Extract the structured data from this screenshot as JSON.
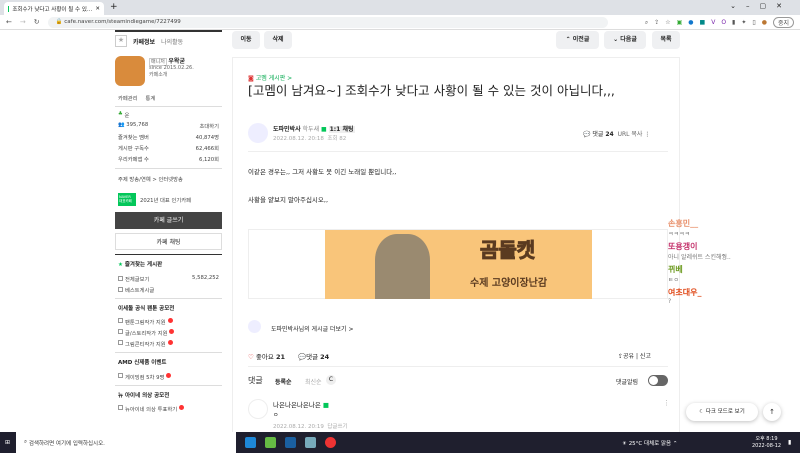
{
  "browser": {
    "tab_title": "조회수가 낮다고 사황이 될 수 있…",
    "url": "cafe.naver.com/steamindiegame/7227499",
    "profile": "중지"
  },
  "sidebar": {
    "tab_info": "카페정보",
    "tab_activity": "나의활동",
    "manager_badge": "매니저",
    "cafe_owner": "우왁굳",
    "since": "since 2015.02.26.",
    "intro": "카페소개",
    "manage": "카페관리",
    "stats": "통계",
    "level": "운",
    "members": "395,768",
    "invite": "초대하기",
    "stats_rows": [
      {
        "label": "즐겨찾는 멤버",
        "value": "40,874명"
      },
      {
        "label": "게시판 구독수",
        "value": "62,466회"
      },
      {
        "label": "우리카페앱 수",
        "value": "6,120회"
      }
    ],
    "topic": "주제 방송/연예 > 인터넷방송",
    "naver_badge": "NAVER 대표카페",
    "award": "2021년 대표 인기카페",
    "write_btn": "카페 글쓰기",
    "chat_btn": "카페 채팅",
    "fav_boards": "즐겨찾는 게시판",
    "boards": [
      {
        "label": "전체글보기",
        "count": "5,582,252"
      },
      {
        "label": "베스트게시글",
        "count": ""
      }
    ],
    "sections": [
      {
        "title": "이세돌 공식 팬툰 공모전",
        "items": [
          "팬툰그림작가 지원",
          "글/스토리작가 지원",
          "그림콘티작가 지원"
        ]
      },
      {
        "title": "AMD 신제품 이벤트",
        "items": [
          "게이밍컴 5차 9명"
        ]
      },
      {
        "title": "뉴 아이네 의상 공모전",
        "items": [
          "뉴아이네 의상 투표하기"
        ]
      }
    ]
  },
  "toolbar": {
    "move": "이동",
    "delete": "삭제",
    "prev": "이전글",
    "next": "다음글",
    "list": "목록"
  },
  "article": {
    "board": "고멤 게시판 >",
    "title": "[고멤이 남겨요~] 조회수가 낮다고 사황이 될 수 있는 것이 아닙니다,,,",
    "author": "도파민박사",
    "grade": "학두새",
    "chat": "1:1 채팅",
    "date": "2022.08.12. 20:18",
    "views": "조회 82",
    "comments_label": "댓글",
    "comments_count": "24",
    "url_copy": "URL 복사",
    "body": [
      "이같은 경우는,, 그저 사황도 못 이긴 노래일 뿐입니다,,",
      "사황을 얕보지 말아주십시오,,"
    ],
    "banner_title": "곰돌캣",
    "banner_sub": "수제 고양이장난감",
    "more_posts": "도파민박사님의 게시글 더보기 >",
    "likes_label": "좋아요",
    "likes": "21",
    "share": "공유",
    "report": "신고",
    "comment_header": "댓글",
    "sort_reg": "등록순",
    "sort_new": "최신순",
    "notify": "댓글알림",
    "comment": {
      "author": "나은나은나은나은",
      "text": "ㅇ",
      "date": "2022.08.12. 20:19",
      "reply": "답글쓰기"
    }
  },
  "chat": [
    {
      "nick": "손흥민__",
      "msg": "ㅋㅋㅋㅋ",
      "color": "#e8906b"
    },
    {
      "nick": "또용갱이",
      "msg": "아니 알레쉬트 스킨해줭..",
      "color": "#c4326b"
    },
    {
      "nick": "뀌베",
      "msg": "ㅌㅇ",
      "color": "#6c9a1f"
    },
    {
      "nick": "여초대우_",
      "msg": "?",
      "color": "#e04a1a"
    }
  ],
  "floating": {
    "dark_mode": "다크 모드로 보기"
  },
  "taskbar": {
    "search": "검색하려면 여기에 입력하십시오.",
    "weather": "25°C 대체로 맑음",
    "time": "오후 8:19",
    "date": "2022-08-12"
  }
}
